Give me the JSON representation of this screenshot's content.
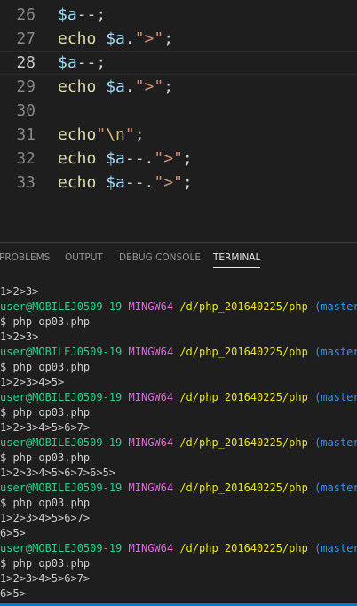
{
  "editor": {
    "lines": [
      {
        "num": "26",
        "tokens": [
          {
            "t": "var",
            "v": "$a"
          },
          {
            "t": "plain",
            "v": "--;"
          }
        ]
      },
      {
        "num": "27",
        "tokens": [
          {
            "t": "kw",
            "v": "echo "
          },
          {
            "t": "var",
            "v": "$a"
          },
          {
            "t": "plain",
            "v": "."
          },
          {
            "t": "str",
            "v": "\">\""
          },
          {
            "t": "plain",
            "v": ";"
          }
        ]
      },
      {
        "num": "28",
        "current": true,
        "tokens": [
          {
            "t": "var",
            "v": "$a"
          },
          {
            "t": "plain",
            "v": "--;"
          }
        ]
      },
      {
        "num": "29",
        "tokens": [
          {
            "t": "kw",
            "v": "echo "
          },
          {
            "t": "var",
            "v": "$a"
          },
          {
            "t": "plain",
            "v": "."
          },
          {
            "t": "str",
            "v": "\">\""
          },
          {
            "t": "plain",
            "v": ";"
          }
        ]
      },
      {
        "num": "30",
        "tokens": []
      },
      {
        "num": "31",
        "tokens": [
          {
            "t": "kw",
            "v": "echo"
          },
          {
            "t": "str",
            "v": "\""
          },
          {
            "t": "esc",
            "v": "\\n"
          },
          {
            "t": "str",
            "v": "\""
          },
          {
            "t": "plain",
            "v": ";"
          }
        ]
      },
      {
        "num": "32",
        "tokens": [
          {
            "t": "kw",
            "v": "echo "
          },
          {
            "t": "var",
            "v": "$a"
          },
          {
            "t": "plain",
            "v": "--."
          },
          {
            "t": "str",
            "v": "\">\""
          },
          {
            "t": "plain",
            "v": ";"
          }
        ]
      },
      {
        "num": "33",
        "tokens": [
          {
            "t": "kw",
            "v": "echo "
          },
          {
            "t": "var",
            "v": "$a"
          },
          {
            "t": "plain",
            "v": "--."
          },
          {
            "t": "str",
            "v": "\">\""
          },
          {
            "t": "plain",
            "v": ";"
          }
        ]
      }
    ]
  },
  "panel": {
    "tabs": [
      {
        "label": "PROBLEMS",
        "active": false
      },
      {
        "label": "OUTPUT",
        "active": false
      },
      {
        "label": "DEBUG CONSOLE",
        "active": false
      },
      {
        "label": "TERMINAL",
        "active": true
      }
    ]
  },
  "prompt": {
    "user": "user@MOBILEJ0509-19",
    "system": "MINGW64",
    "path": "/d/php_201640225/php",
    "branch": "(master)",
    "command": "$ php op03.php"
  },
  "terminal": {
    "lines": [
      {
        "type": "text",
        "text": "1>2>3>"
      },
      {
        "type": "prompt"
      },
      {
        "type": "cmd"
      },
      {
        "type": "text",
        "text": "1>2>3>"
      },
      {
        "type": "prompt"
      },
      {
        "type": "cmd"
      },
      {
        "type": "text",
        "text": "1>2>3>4>5>"
      },
      {
        "type": "prompt"
      },
      {
        "type": "cmd"
      },
      {
        "type": "text",
        "text": "1>2>3>4>5>6>7>"
      },
      {
        "type": "prompt"
      },
      {
        "type": "cmd"
      },
      {
        "type": "text",
        "text": "1>2>3>4>5>6>7>6>5>"
      },
      {
        "type": "prompt"
      },
      {
        "type": "cmd"
      },
      {
        "type": "text",
        "text": "1>2>3>4>5>6>7>"
      },
      {
        "type": "text",
        "text": "6>5>"
      },
      {
        "type": "prompt"
      },
      {
        "type": "cmd"
      },
      {
        "type": "text",
        "text": "1>2>3>4>5>6>7>"
      },
      {
        "type": "text",
        "text": "6>5>"
      }
    ]
  },
  "colors": {
    "background": "#1e1e1e",
    "user": "#23d18b",
    "system": "#d670d6",
    "path": "#e5e510",
    "branch": "#3b8eea",
    "accent": "#007acc"
  }
}
